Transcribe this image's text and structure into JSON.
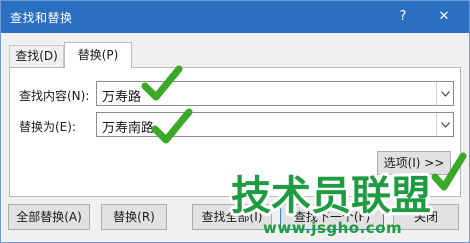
{
  "window": {
    "title": "查找和替换",
    "help_label": "?",
    "close_label": "✕"
  },
  "tabs": [
    {
      "label": "查找(D)",
      "active": false
    },
    {
      "label": "替换(P)",
      "active": true
    }
  ],
  "find_field": {
    "label": "查找内容(N):",
    "value": "万寿路",
    "arrow_icon": "chevron-down-icon"
  },
  "replace_field": {
    "label": "替换为(E):",
    "value": "万寿南路",
    "arrow_icon": "chevron-down-icon"
  },
  "options_button": "选项(I) >>",
  "buttons": {
    "replace_all": "全部替换(A)",
    "replace": "替换(R)",
    "find_all": "查找全部(I)",
    "find_next": "查找下一个(F)",
    "close": "关闭"
  },
  "watermark": {
    "logo_text": "技术员联盟",
    "url": "www.jsgho.com"
  },
  "colors": {
    "titlebar": "#2b6fc2",
    "check": "#3aa928",
    "watermark": "#1f9c42"
  }
}
